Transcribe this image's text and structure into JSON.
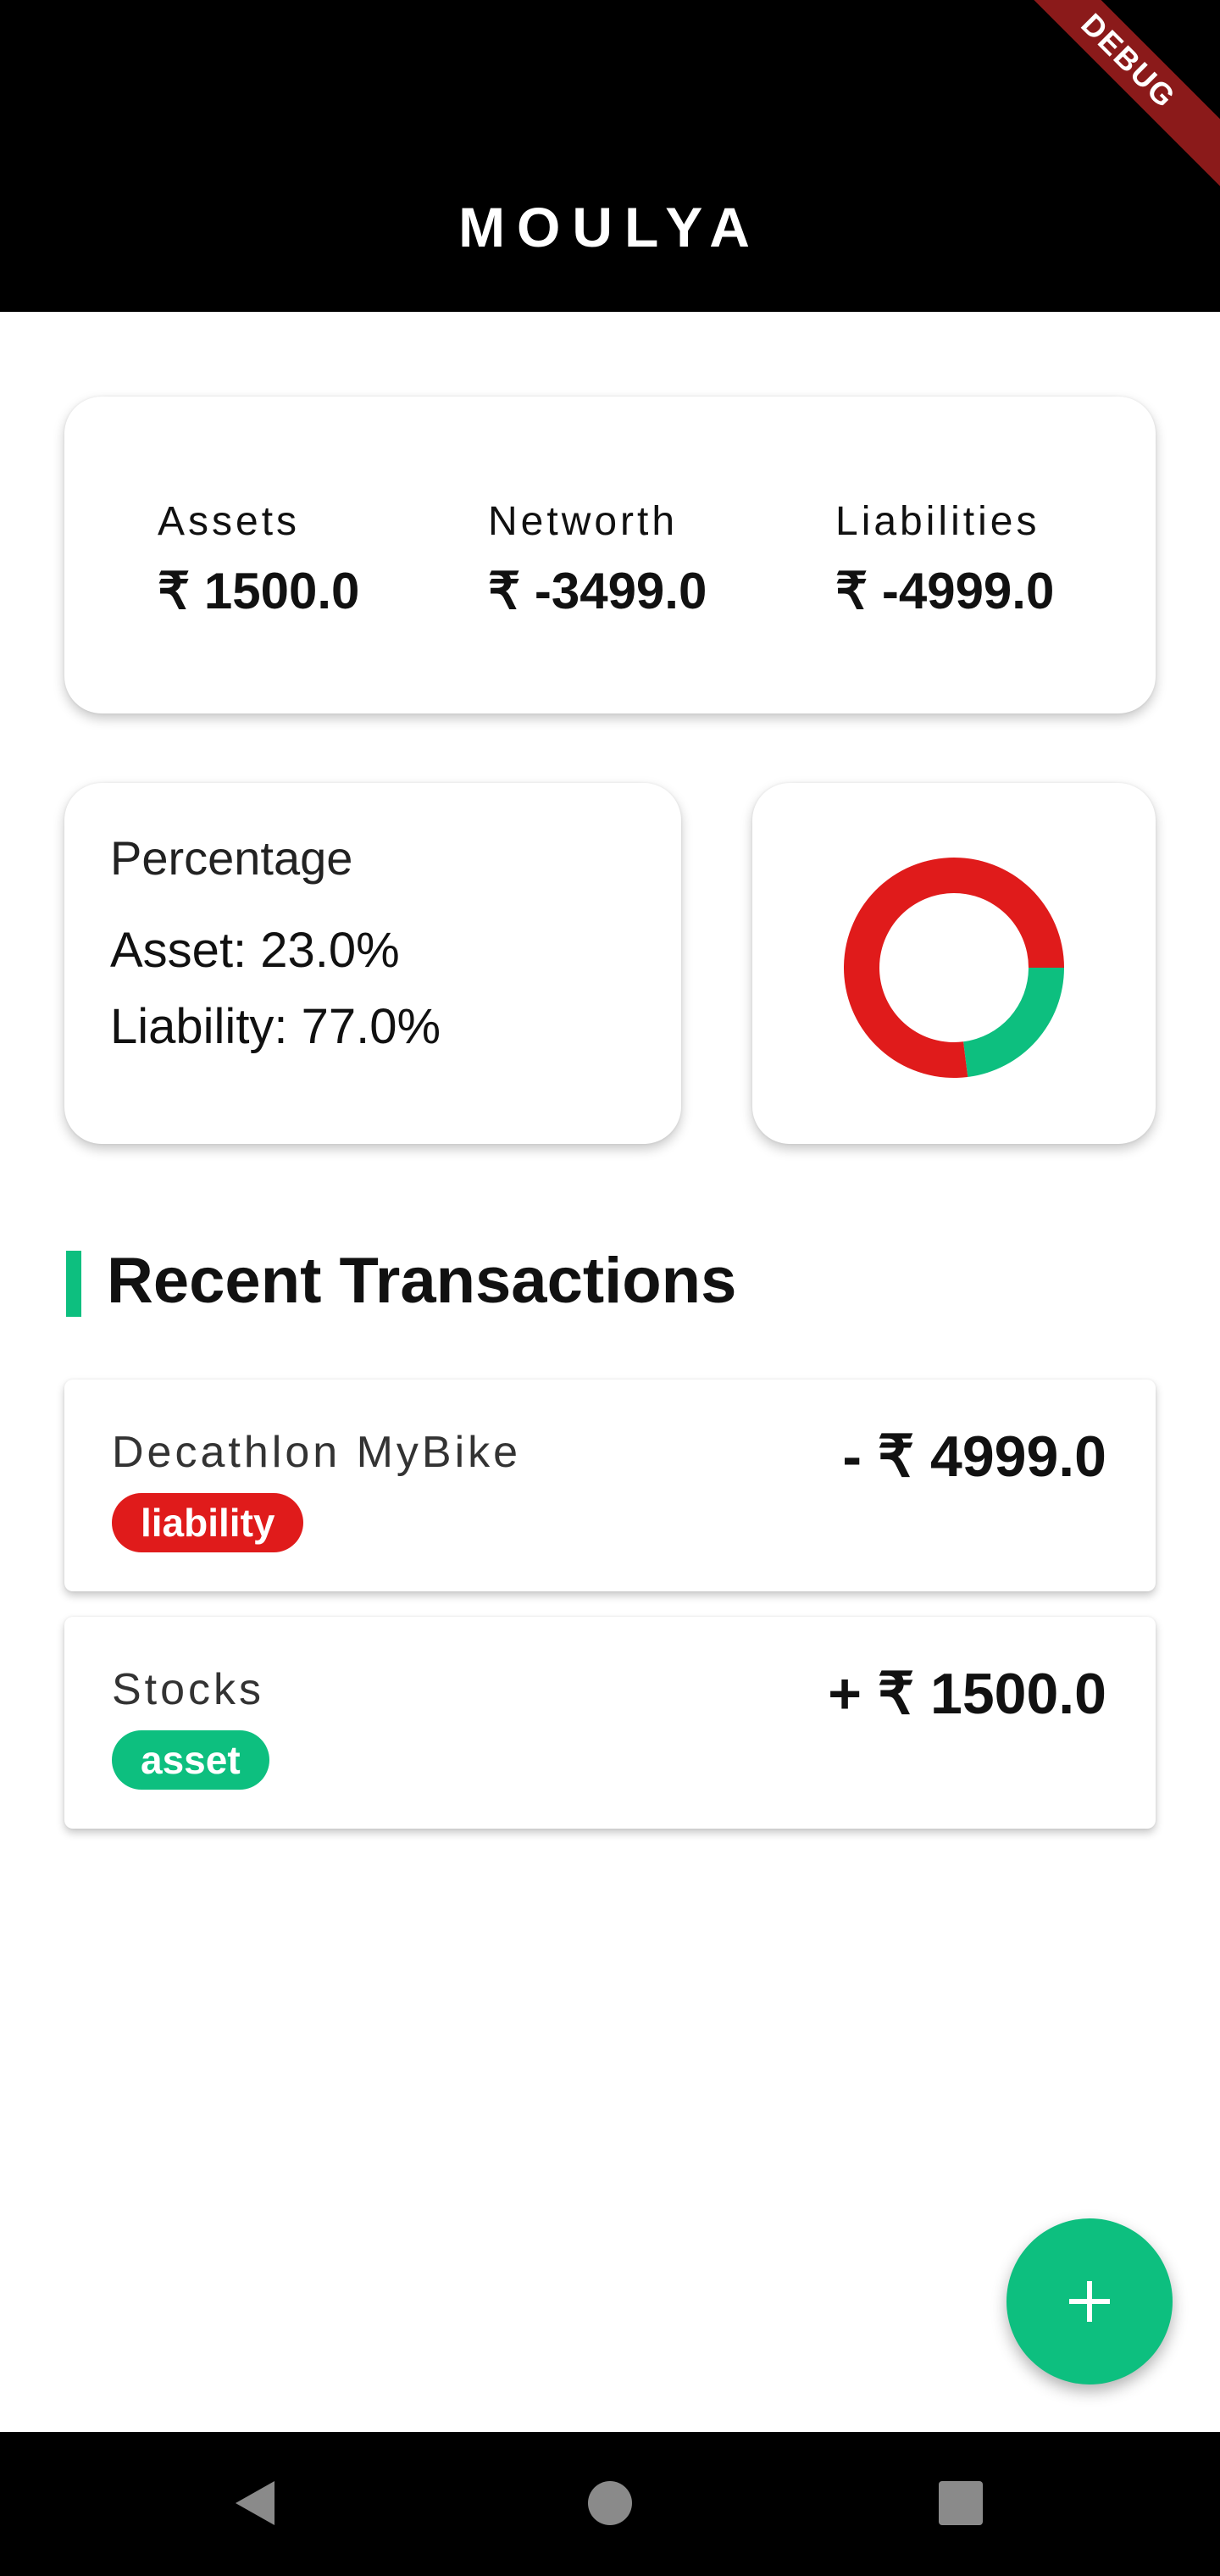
{
  "app": {
    "title": "MOULYA",
    "debug_banner": "DEBUG"
  },
  "summary": {
    "assets": {
      "label": "Assets",
      "value": "₹ 1500.0"
    },
    "networth": {
      "label": "Networth",
      "value": "₹ -3499.0"
    },
    "liabilities": {
      "label": "Liabilities",
      "value": "₹ -4999.0"
    }
  },
  "percentage": {
    "title": "Percentage",
    "asset_text": "Asset: 23.0%",
    "liability_text": "Liability: 77.0%"
  },
  "donut": {
    "asset_fraction": 0.23,
    "liability_fraction": 0.77,
    "asset_color": "#0dbf7f",
    "liability_color": "#e01b1b"
  },
  "recent": {
    "title": "Recent Transactions",
    "accent_color": "#0dbf7f",
    "items": [
      {
        "name": "Decathlon MyBike",
        "tag": "liability",
        "tag_color": "#e01b1b",
        "amount": "- ₹ 4999.0"
      },
      {
        "name": "Stocks",
        "tag": "asset",
        "tag_color": "#0dbf7f",
        "amount": "+ ₹ 1500.0"
      }
    ]
  },
  "fab": {
    "icon": "plus-icon"
  },
  "navbar": {
    "icons": [
      "back-triangle-icon",
      "home-circle-icon",
      "recents-square-icon"
    ]
  }
}
